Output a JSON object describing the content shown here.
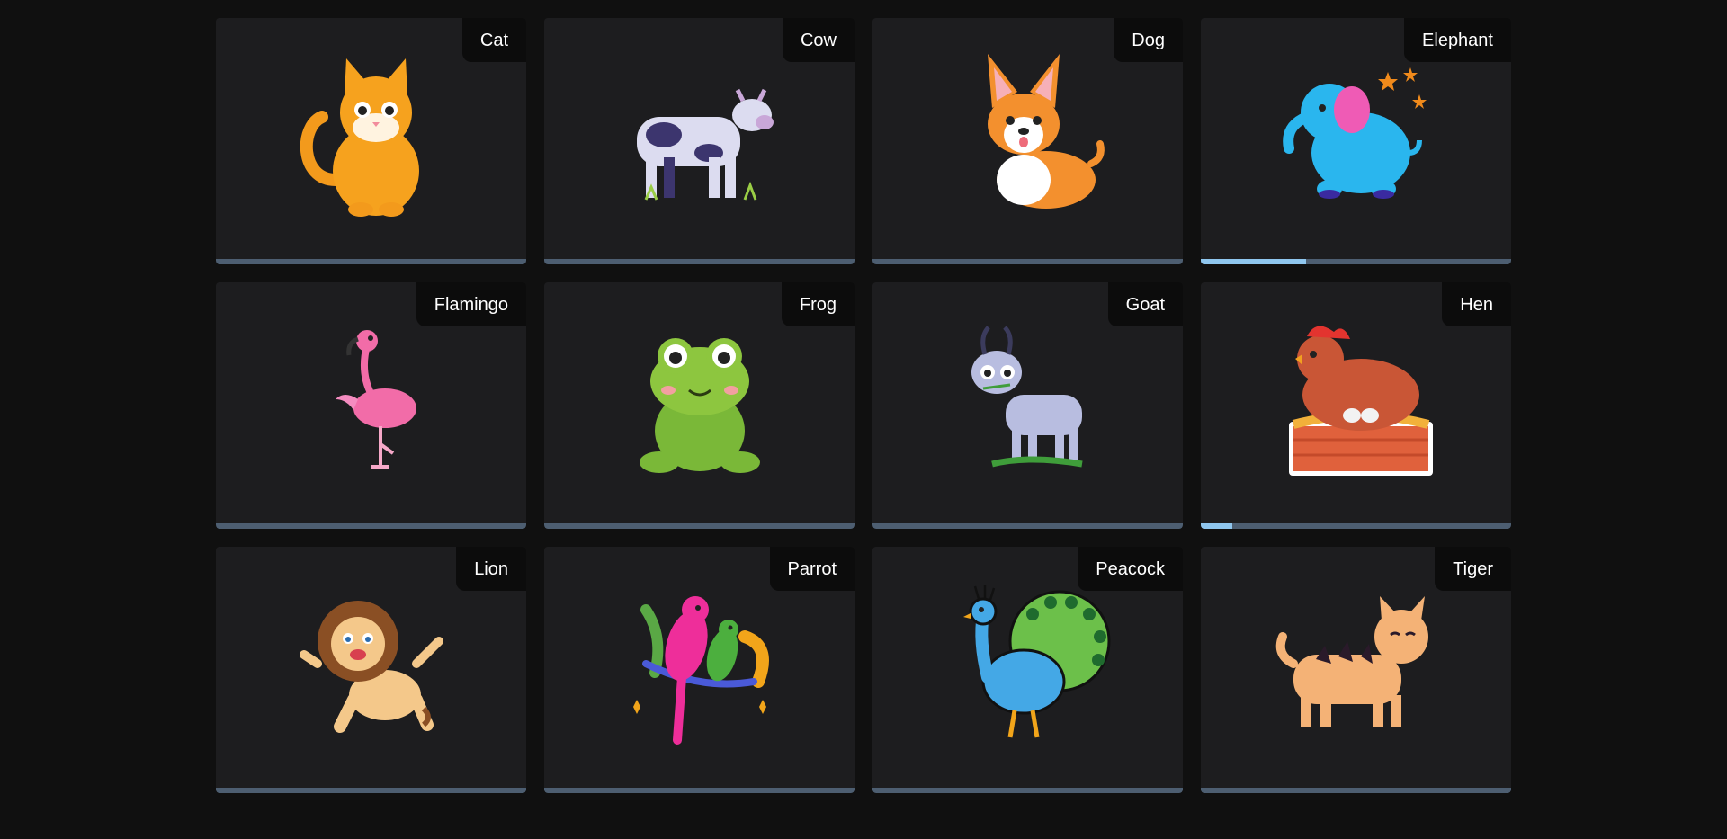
{
  "cards": [
    {
      "label": "Cat",
      "progress": 0
    },
    {
      "label": "Cow",
      "progress": 0
    },
    {
      "label": "Dog",
      "progress": 0
    },
    {
      "label": "Elephant",
      "progress": 0.34
    },
    {
      "label": "Flamingo",
      "progress": 0
    },
    {
      "label": "Frog",
      "progress": 0
    },
    {
      "label": "Goat",
      "progress": 0
    },
    {
      "label": "Hen",
      "progress": 0.1
    },
    {
      "label": "Lion",
      "progress": 0
    },
    {
      "label": "Parrot",
      "progress": 0
    },
    {
      "label": "Peacock",
      "progress": 0
    },
    {
      "label": "Tiger",
      "progress": 0
    }
  ],
  "colors": {
    "page_background": "#101010",
    "card_background": "#1d1d1f",
    "label_background": "#0c0c0c",
    "progress_track": "#4d5e71",
    "progress_fill": "#8fc6ee"
  }
}
